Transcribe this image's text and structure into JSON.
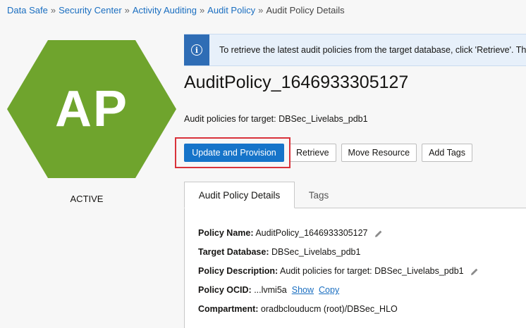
{
  "breadcrumb": {
    "items": [
      "Data Safe",
      "Security Center",
      "Activity Auditing",
      "Audit Policy"
    ],
    "separator": "»",
    "current": "Audit Policy Details"
  },
  "avatar": {
    "initials": "AP",
    "color": "#6fa42d",
    "status": "ACTIVE"
  },
  "info_banner": {
    "icon": "info-icon",
    "text": "To retrieve the latest audit policies from the target database, click 'Retrieve'. The"
  },
  "title": "AuditPolicy_1646933305127",
  "subtitle": "Audit policies for target: DBSec_Livelabs_pdb1",
  "actions": {
    "update_provision": "Update and Provision",
    "retrieve": "Retrieve",
    "move_resource": "Move Resource",
    "add_tags": "Add Tags"
  },
  "tabs": [
    {
      "label": "Audit Policy Details",
      "active": true
    },
    {
      "label": "Tags",
      "active": false
    }
  ],
  "details": {
    "policy_name_label": "Policy Name:",
    "policy_name_value": "AuditPolicy_1646933305127",
    "target_db_label": "Target Database:",
    "target_db_value": "DBSec_Livelabs_pdb1",
    "description_label": "Policy Description:",
    "description_value": "Audit policies for target: DBSec_Livelabs_pdb1",
    "ocid_label": "Policy OCID:",
    "ocid_value": "...lvmi5a",
    "ocid_show": "Show",
    "ocid_copy": "Copy",
    "compartment_label": "Compartment:",
    "compartment_value": "oradbclouducm (root)/DBSec_HLO"
  },
  "colors": {
    "primary": "#1674c9",
    "link": "#1a6ec0",
    "highlight": "#d9323a",
    "info": "#2f6db5"
  }
}
